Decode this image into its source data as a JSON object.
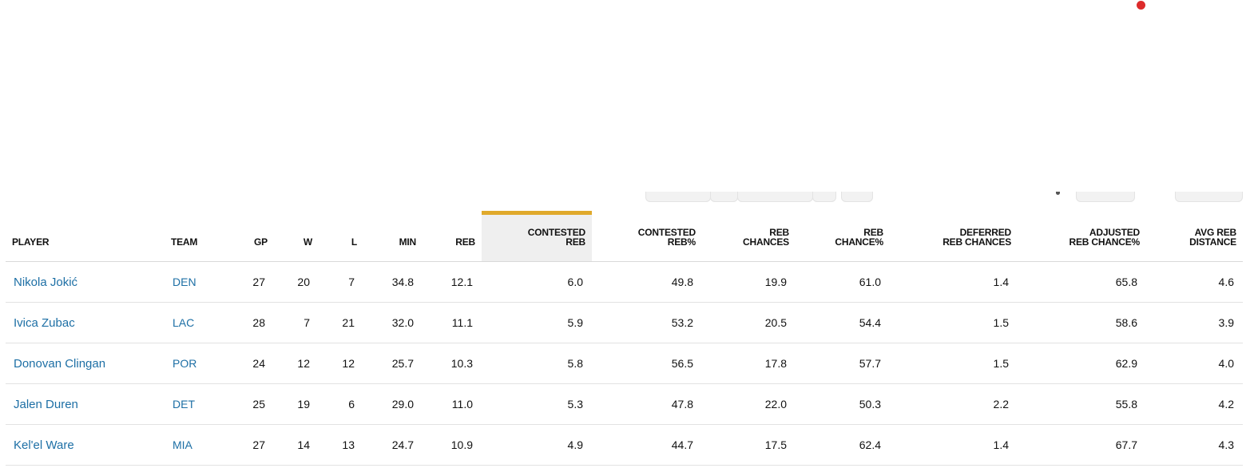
{
  "table": {
    "columns": [
      {
        "key": "player",
        "lines": [
          "PLAYER"
        ]
      },
      {
        "key": "team",
        "lines": [
          "TEAM"
        ]
      },
      {
        "key": "gp",
        "lines": [
          "GP"
        ]
      },
      {
        "key": "w",
        "lines": [
          "W"
        ]
      },
      {
        "key": "l",
        "lines": [
          "L"
        ]
      },
      {
        "key": "min",
        "lines": [
          "MIN"
        ]
      },
      {
        "key": "reb",
        "lines": [
          "REB"
        ]
      },
      {
        "key": "contested_reb",
        "lines": [
          "CONTESTED",
          "REB"
        ]
      },
      {
        "key": "contested_reb_pct",
        "lines": [
          "CONTESTED",
          "REB%"
        ]
      },
      {
        "key": "reb_chances",
        "lines": [
          "REB",
          "CHANCES"
        ]
      },
      {
        "key": "reb_chance_pct",
        "lines": [
          "REB",
          "CHANCE%"
        ]
      },
      {
        "key": "deferred_reb_chances",
        "lines": [
          "DEFERRED",
          "REB CHANCES"
        ]
      },
      {
        "key": "adjusted_reb_chance_pct",
        "lines": [
          "ADJUSTED",
          "REB CHANCE%"
        ]
      },
      {
        "key": "avg_reb_distance",
        "lines": [
          "AVG REB",
          "DISTANCE"
        ]
      }
    ],
    "sorted_column": "contested_reb",
    "rows": [
      [
        "Nikola Jokić",
        "DEN",
        "27",
        "20",
        "7",
        "34.8",
        "12.1",
        "6.0",
        "49.8",
        "19.9",
        "61.0",
        "1.4",
        "65.8",
        "4.6"
      ],
      [
        "Ivica Zubac",
        "LAC",
        "28",
        "7",
        "21",
        "32.0",
        "11.1",
        "5.9",
        "53.2",
        "20.5",
        "54.4",
        "1.5",
        "58.6",
        "3.9"
      ],
      [
        "Donovan Clingan",
        "POR",
        "24",
        "12",
        "12",
        "25.7",
        "10.3",
        "5.8",
        "56.5",
        "17.8",
        "57.7",
        "1.5",
        "62.9",
        "4.0"
      ],
      [
        "Jalen Duren",
        "DET",
        "25",
        "19",
        "6",
        "29.0",
        "11.0",
        "5.3",
        "47.8",
        "22.0",
        "50.3",
        "2.2",
        "55.8",
        "4.2"
      ],
      [
        "Kel'el Ware",
        "MIA",
        "27",
        "14",
        "13",
        "24.7",
        "10.9",
        "4.9",
        "44.7",
        "17.5",
        "62.4",
        "1.4",
        "67.7",
        "4.3"
      ]
    ]
  },
  "colors": {
    "link": "#1d6fa5",
    "sort_accent": "#e0a92b",
    "sorted_header_bg": "#efefef",
    "notification_dot": "#dd2b2b"
  },
  "icons": {
    "notification": "notification-dot-icon"
  }
}
